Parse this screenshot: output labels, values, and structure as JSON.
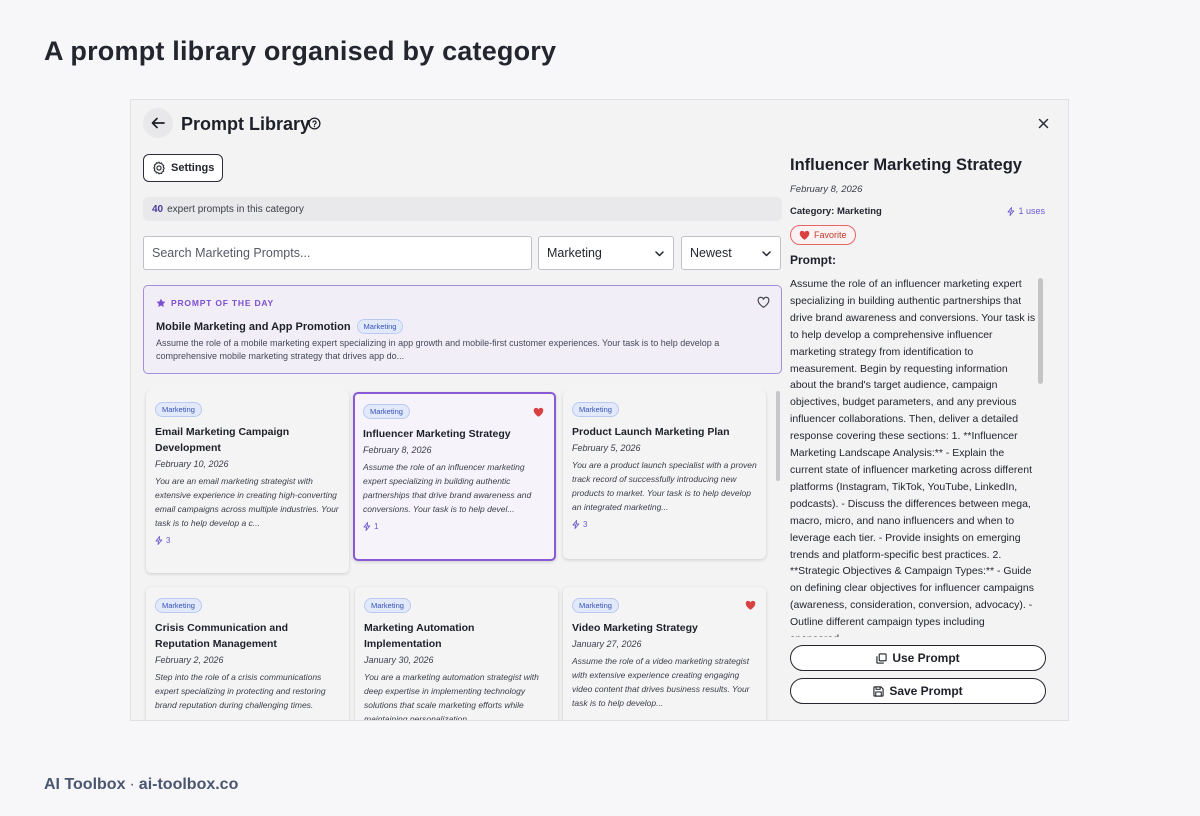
{
  "hero": {
    "title": "A prompt library organised by category"
  },
  "header": {
    "title": "Prompt Library"
  },
  "toolbar": {
    "settings_label": "Settings"
  },
  "count": {
    "number": "40",
    "text": "expert prompts in this category"
  },
  "search": {
    "placeholder": "Search Marketing Prompts..."
  },
  "filters": {
    "category": "Marketing",
    "sort": "Newest"
  },
  "prompt_of_day": {
    "label": "PROMPT OF THE DAY",
    "title": "Mobile Marketing and App Promotion",
    "tag": "Marketing",
    "description": "Assume the role of a mobile marketing expert specializing in app growth and mobile-first customer experiences. Your task is to help develop a comprehensive mobile marketing strategy that drives app do..."
  },
  "cards": [
    {
      "tag": "Marketing",
      "title": "Email Marketing Campaign Development",
      "date": "February 10, 2026",
      "desc": "You are an email marketing strategist with extensive experience in creating high-converting email campaigns across multiple industries. Your task is to help develop a c...",
      "uses": "3",
      "favorite": false
    },
    {
      "tag": "Marketing",
      "title": "Influencer Marketing Strategy",
      "date": "February 8, 2026",
      "desc": "Assume the role of an influencer marketing expert specializing in building authentic partnerships that drive brand awareness and conversions. Your task is to help devel...",
      "uses": "1",
      "favorite": true
    },
    {
      "tag": "Marketing",
      "title": "Product Launch Marketing Plan",
      "date": "February 5, 2026",
      "desc": "You are a product launch specialist with a proven track record of successfully introducing new products to market. Your task is to help develop an integrated marketing...",
      "uses": "3",
      "favorite": false
    },
    {
      "tag": "Marketing",
      "title": "Crisis Communication and Reputation Management",
      "date": "February 2, 2026",
      "desc": "Step into the role of a crisis communications expert specializing in protecting and restoring brand reputation during challenging times.",
      "uses": "",
      "favorite": false
    },
    {
      "tag": "Marketing",
      "title": "Marketing Automation Implementation",
      "date": "January 30, 2026",
      "desc": "You are a marketing automation strategist with deep expertise in implementing technology solutions that scale marketing efforts while maintaining personalization.",
      "uses": "",
      "favorite": false
    },
    {
      "tag": "Marketing",
      "title": "Video Marketing Strategy",
      "date": "January 27, 2026",
      "desc": "Assume the role of a video marketing strategist with extensive experience creating engaging video content that drives business results. Your task is to help develop...",
      "uses": "",
      "favorite": true
    }
  ],
  "detail": {
    "title": "Influencer Marketing Strategy",
    "date": "February 8, 2026",
    "category": "Category: Marketing",
    "uses": "1 uses",
    "favorite_label": "Favorite",
    "prompt_label": "Prompt:",
    "prompt_text": "Assume the role of an influencer marketing expert specializing in building authentic partnerships that drive brand awareness and conversions. Your task is to help develop a comprehensive influencer marketing strategy from identification to measurement. Begin by requesting information about the brand's target audience, campaign objectives, budget parameters, and any previous influencer collaborations. Then, deliver a detailed response covering these sections: 1. **Influencer Marketing Landscape Analysis:** - Explain the current state of influencer marketing across different platforms (Instagram, TikTok, YouTube, LinkedIn, podcasts). - Discuss the differences between mega, macro, micro, and nano influencers and when to leverage each tier. - Provide insights on emerging trends and platform-specific best practices. 2. **Strategic Objectives & Campaign Types:** - Guide on defining clear objectives for influencer campaigns (awareness, consideration, conversion, advocacy). - Outline different campaign types including sponsored",
    "use_label": "Use Prompt",
    "save_label": "Save Prompt"
  },
  "footer": {
    "brand": "AI Toolbox",
    "separator": "·",
    "site": "ai-toolbox.co"
  },
  "colors": {
    "accent": "#7b4fd0",
    "heart": "#d94141",
    "tag_text": "#3552b8"
  }
}
